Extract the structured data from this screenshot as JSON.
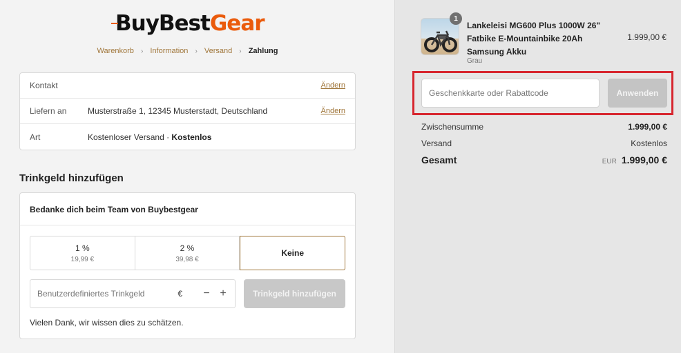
{
  "brand": {
    "logo_part1": "BuyBest",
    "logo_part2": "Gear",
    "accent_color": "#ea5b0c",
    "link_color": "#a0763a"
  },
  "breadcrumb": {
    "items": [
      "Warenkorb",
      "Information",
      "Versand",
      "Zahlung"
    ],
    "separator": "›"
  },
  "review": {
    "rows": [
      {
        "label": "Kontakt",
        "value": "",
        "action": "Ändern"
      },
      {
        "label": "Liefern an",
        "value": "Musterstraße 1, 12345 Musterstadt, Deutschland",
        "action": "Ändern"
      },
      {
        "label": "Art",
        "value": "Kostenloser Versand · ",
        "value_bold": "Kostenlos"
      }
    ]
  },
  "tip": {
    "heading": "Trinkgeld hinzufügen",
    "box_title": "Bedanke dich beim Team von Buybestgear",
    "options": [
      {
        "pct": "1 %",
        "amount": "19,99 €"
      },
      {
        "pct": "2 %",
        "amount": "39,98 €"
      },
      {
        "pct": "Keine"
      }
    ],
    "selected_index": 2,
    "custom_placeholder": "Benutzerdefiniertes Trinkgeld",
    "currency": "€",
    "minus": "−",
    "plus": "+",
    "add_button": "Trinkgeld hinzufügen",
    "thanks": "Vielen Dank, wir wissen dies zu schätzen."
  },
  "order": {
    "product_name": "Lankeleisi MG600 Plus 1000W 26\" Fatbike E-Mountainbike 20Ah Samsung Akku",
    "product_variant": "Grau",
    "product_price": "1.999,00 €",
    "quantity": "1",
    "discount_placeholder": "Geschenkkarte oder Rabattcode",
    "apply_button": "Anwenden",
    "subtotal_label": "Zwischensumme",
    "subtotal_value": "1.999,00 €",
    "shipping_label": "Versand",
    "shipping_value": "Kostenlos",
    "total_label": "Gesamt",
    "total_currency": "EUR",
    "total_value": "1.999,00 €",
    "highlight_color": "#d7262f"
  }
}
